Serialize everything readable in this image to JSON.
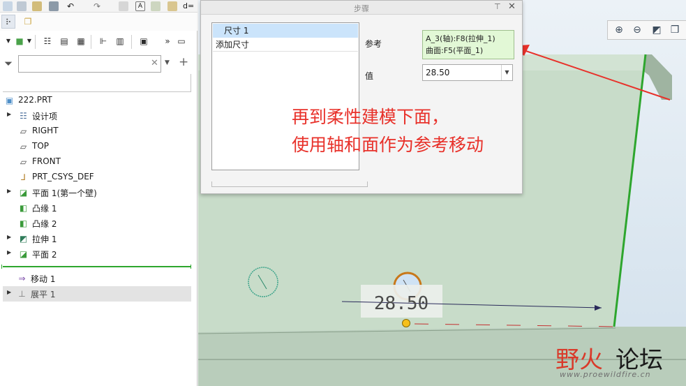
{
  "dialog": {
    "title": "步骤",
    "list": [
      "尺寸 1",
      "添加尺寸"
    ],
    "ref_label": "参考",
    "ref_lines": [
      "A_3(轴):F8(拉伸_1)",
      "曲面:F5(平面_1)"
    ],
    "value_label": "值",
    "value": "28.50"
  },
  "tree": {
    "items": [
      {
        "label": "222.PRT",
        "icon": "part-icon",
        "expandable": false
      },
      {
        "label": "设计项",
        "icon": "design-items-icon",
        "expandable": true
      },
      {
        "label": "RIGHT",
        "icon": "datum-plane-icon",
        "expandable": false
      },
      {
        "label": "TOP",
        "icon": "datum-plane-icon",
        "expandable": false
      },
      {
        "label": "FRONT",
        "icon": "datum-plane-icon",
        "expandable": false
      },
      {
        "label": "PRT_CSYS_DEF",
        "icon": "csys-icon",
        "expandable": false
      },
      {
        "label": "平面 1(第一个壁)",
        "icon": "planar-wall-icon",
        "expandable": true
      },
      {
        "label": "凸缘 1",
        "icon": "flange-icon",
        "expandable": false
      },
      {
        "label": "凸缘 2",
        "icon": "flange-icon",
        "expandable": false
      },
      {
        "label": "拉伸 1",
        "icon": "extrude-icon",
        "expandable": true
      },
      {
        "label": "平面 2",
        "icon": "planar-wall-icon",
        "expandable": true
      },
      {
        "label": "移动 1",
        "icon": "move-icon",
        "expandable": false
      },
      {
        "label": "展平 1",
        "icon": "flatten-icon",
        "expandable": true
      }
    ]
  },
  "model": {
    "dimension_value": "28.50"
  },
  "annotation": {
    "line1": "再到柔性建模下面，",
    "line2": "使用轴和面作为参考移动"
  },
  "watermark": {
    "part1": "野火",
    "part2": "论坛",
    "url": "www.proewildfire.cn"
  },
  "colors": {
    "annotation": "#e8312a",
    "ref_bg": "#e2f8d6",
    "selection": "#cbe4fb",
    "model_face": "#c8dcc9",
    "insert_line": "#2ea62e"
  }
}
